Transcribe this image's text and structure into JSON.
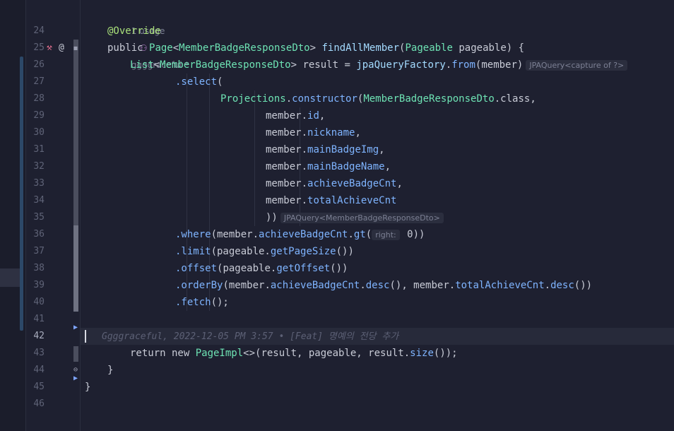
{
  "gutter": {
    "line_numbers": [
      "24",
      "25",
      "26",
      "27",
      "28",
      "29",
      "30",
      "31",
      "32",
      "33",
      "34",
      "35",
      "36",
      "37",
      "38",
      "39",
      "40",
      "41",
      "42",
      "43",
      "44",
      "45",
      "46"
    ],
    "icons": {
      "implementation": "implement-icon",
      "annotation": "at-icon"
    }
  },
  "code": {
    "usage_count": "1 usage",
    "author": "ggggraceful *",
    "line_override": "@Override",
    "l25": {
      "public": "public",
      "page": "Page",
      "lt": "<",
      "dto": "MemberBadgeResponseDto",
      "gt": "> ",
      "fn": "findAllMember",
      "p1": "(",
      "pageable_type": "Pageable",
      "rest": " pageable) {"
    },
    "l26": {
      "list": "List",
      "lt": "<",
      "dto": "MemberBadgeResponseDto",
      "gt": "> result = ",
      "fn": "jpaQueryFactory",
      "dot": ".",
      "from": "from",
      "args": "(member)",
      "hint": "JPAQuery<capture of ?>"
    },
    "l27": {
      "select": ".select",
      "p": "("
    },
    "l28": {
      "proj": "Projections",
      "dot": ".",
      "ctor": "constructor",
      "p": "(",
      "dto": "MemberBadgeResponseDto",
      "cls": ".class,"
    },
    "l29": {
      "obj": "member.",
      "f": "id",
      "c": ","
    },
    "l30": {
      "obj": "member.",
      "f": "nickname",
      "c": ","
    },
    "l31": {
      "obj": "member.",
      "f": "mainBadgeImg",
      "c": ","
    },
    "l32": {
      "obj": "member.",
      "f": "mainBadgeName",
      "c": ","
    },
    "l33": {
      "obj": "member.",
      "f": "achieveBadgeCnt",
      "c": ","
    },
    "l34": {
      "obj": "member.",
      "f": "totalAchieveCnt",
      "c": ""
    },
    "l35": {
      "close": "))",
      "hint": "JPAQuery<MemberBadgeResponseDto>"
    },
    "l36": {
      "where": ".where",
      "a": "(member.",
      "f": "achieveBadgeCnt",
      "d": ".",
      "gt": "gt",
      "p": "(",
      "param": "right:",
      "val": " 0))"
    },
    "l37": {
      "limit": ".limit",
      "a": "(pageable.",
      "m": "getPageSize",
      "e": "())"
    },
    "l38": {
      "offset": ".offset",
      "a": "(pageable.",
      "m": "getOffset",
      "e": "())"
    },
    "l39": {
      "order": ".orderBy",
      "a": "(member.",
      "f1": "achieveBadgeCnt",
      "d1": ".",
      "desc1": "desc",
      "b": "(), member.",
      "f2": "totalAchieveCnt",
      "d2": ".",
      "desc2": "desc",
      "e": "())"
    },
    "l40": {
      "fetch": ".fetch",
      "e": "();"
    },
    "l42_blame": "Ggggraceful, 2022-12-05 PM 3:57 • [Feat] 명예의 전당 추가",
    "l43": {
      "ret": "return new ",
      "impl": "PageImpl",
      "a": "<>(result, pageable, result.",
      "size": "size",
      "e": "());"
    },
    "l44": "}",
    "l45": "}"
  },
  "colors": {
    "background": "#1e2030",
    "type": "#6ee3b4",
    "method": "#7fb4ff",
    "annotation": "#a9e07a"
  }
}
